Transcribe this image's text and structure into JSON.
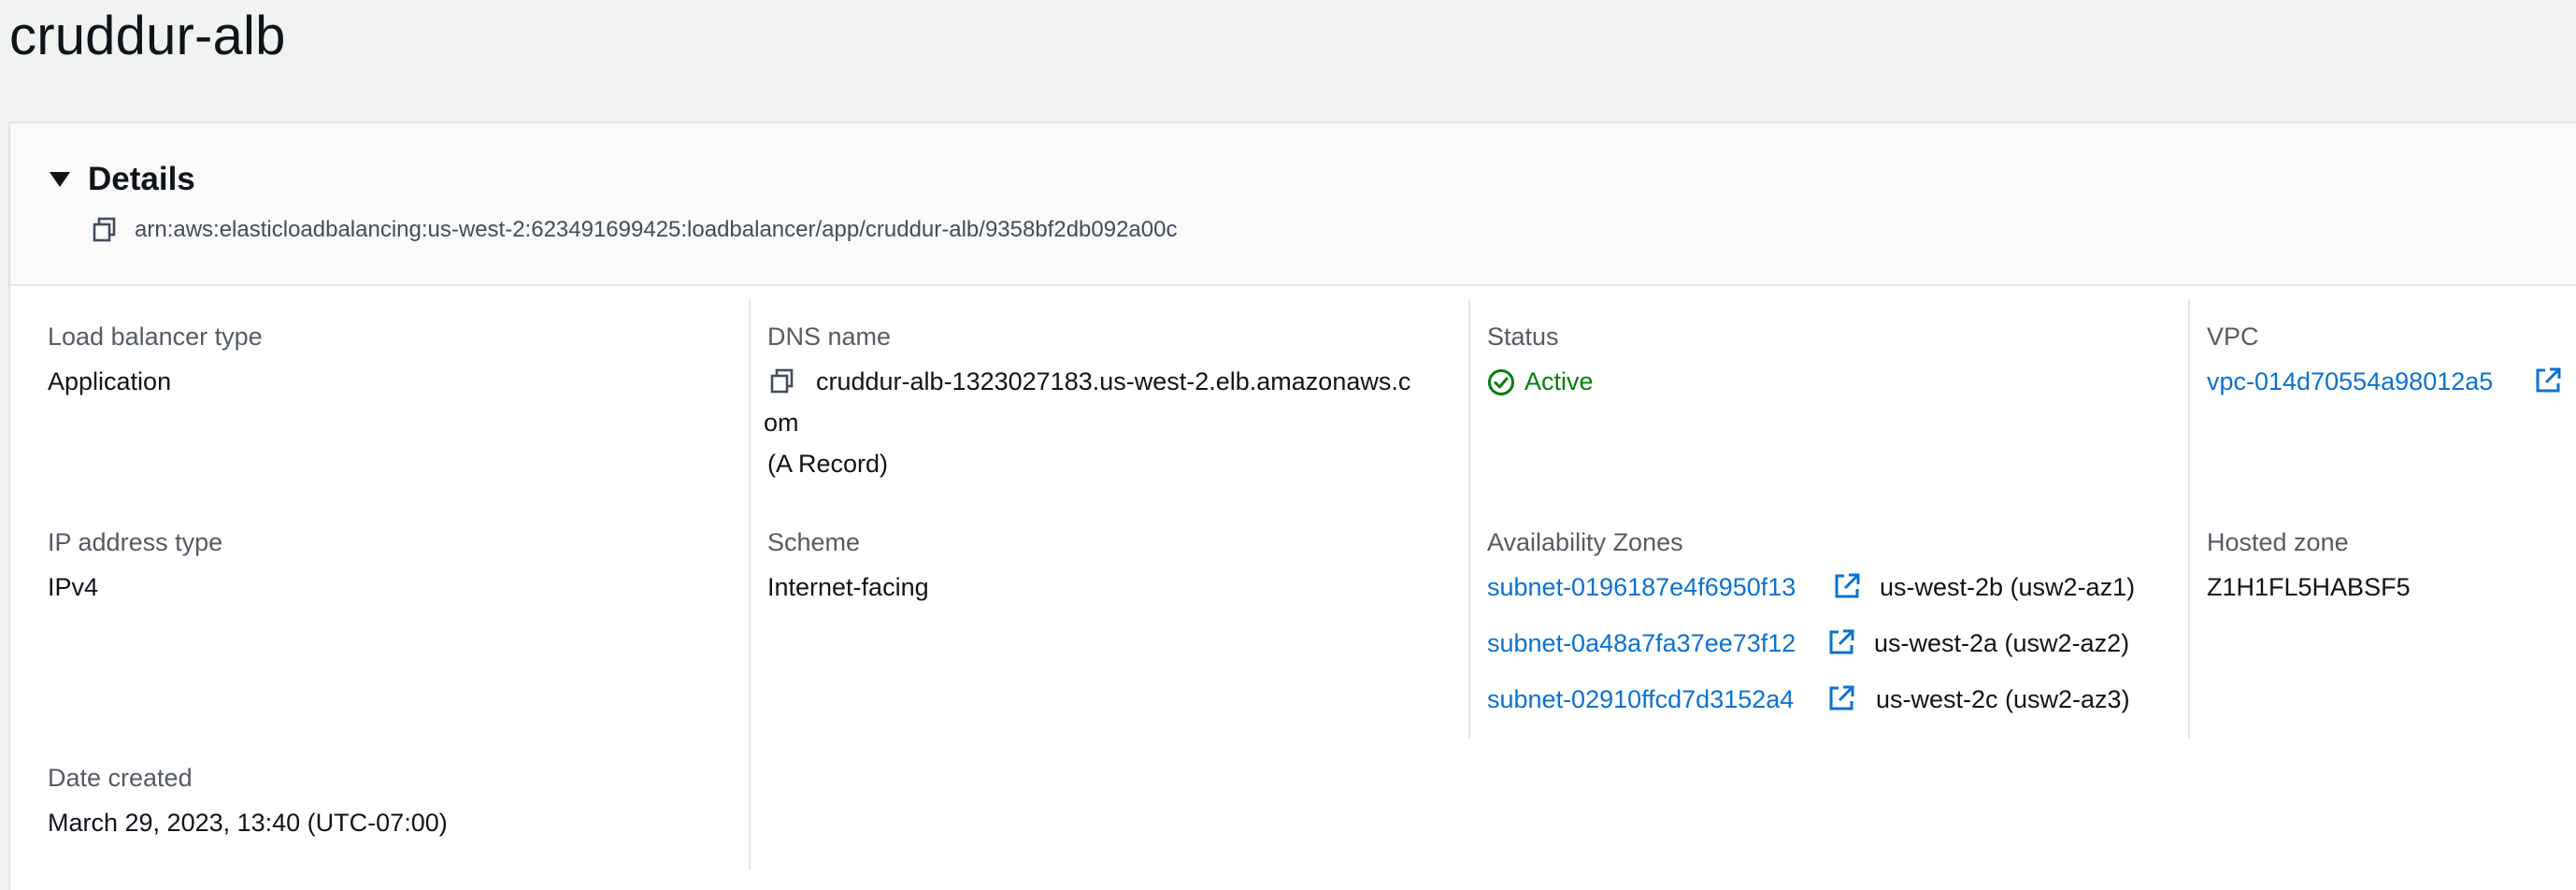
{
  "page": {
    "title": "cruddur-alb"
  },
  "details": {
    "heading": "Details",
    "arn": "arn:aws:elasticloadbalancing:us-west-2:623491699425:loadbalancer/app/cruddur-alb/9358bf2db092a00c"
  },
  "fields": {
    "load_balancer_type": {
      "label": "Load balancer type",
      "value": "Application"
    },
    "dns_name": {
      "label": "DNS name",
      "value_line1": "cruddur-alb-1323027183.us-west-2.elb.amazonaws.c",
      "value_line2": "om",
      "record": "(A Record)"
    },
    "status": {
      "label": "Status",
      "value": "Active",
      "color": "#037f0c"
    },
    "vpc": {
      "label": "VPC",
      "value": "vpc-014d70554a98012a5"
    },
    "ip_address_type": {
      "label": "IP address type",
      "value": "IPv4"
    },
    "scheme": {
      "label": "Scheme",
      "value": "Internet-facing"
    },
    "availability_zones": {
      "label": "Availability Zones",
      "items": [
        {
          "subnet": "subnet-0196187e4f6950f13",
          "zone": "us-west-2b (usw2-az1)"
        },
        {
          "subnet": "subnet-0a48a7fa37ee73f12",
          "zone": "us-west-2a (usw2-az2)"
        },
        {
          "subnet": "subnet-02910ffcd7d3152a4",
          "zone": "us-west-2c (usw2-az3)"
        }
      ]
    },
    "hosted_zone": {
      "label": "Hosted zone",
      "value": "Z1H1FL5HABSF5"
    },
    "date_created": {
      "label": "Date created",
      "value": "March 29, 2023, 13:40 (UTC-07:00)"
    }
  },
  "icons": {
    "copy": "copy-icon",
    "external": "external-link-icon",
    "status": "status-positive-icon",
    "toggle": "caret-down-icon"
  },
  "colors": {
    "link": "#0972d3",
    "success": "#037f0c",
    "label": "#545b64",
    "text": "#0f141a"
  }
}
